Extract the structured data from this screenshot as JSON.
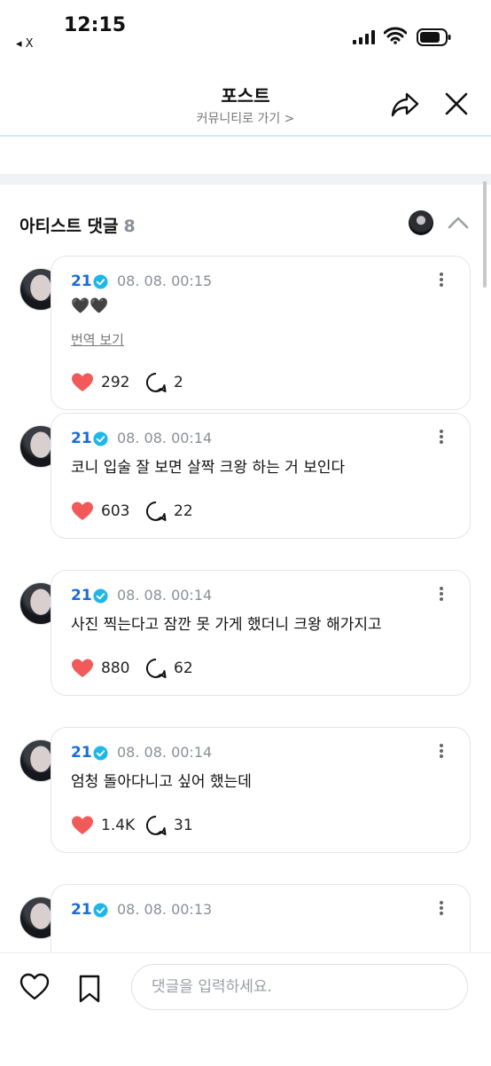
{
  "status_bar": {
    "time": "12:15",
    "back_app": "◂ X"
  },
  "header": {
    "title": "포스트",
    "subtitle": "커뮤니티로 가기 >"
  },
  "section": {
    "title": "아티스트 댓글",
    "count": "8"
  },
  "comments": [
    {
      "author": "21",
      "timestamp": "08. 08. 00:15",
      "text": "🖤🖤",
      "translate": "번역 보기",
      "likes": "292",
      "replies": "2"
    },
    {
      "author": "21",
      "timestamp": "08. 08. 00:14",
      "text": "코니 입술 잘 보면 살짝 크왕 하는 거 보인다",
      "likes": "603",
      "replies": "22"
    },
    {
      "author": "21",
      "timestamp": "08. 08. 00:14",
      "text": "사진 찍는다고 잠깐 못 가게 했더니 크왕 해가지고",
      "likes": "880",
      "replies": "62"
    },
    {
      "author": "21",
      "timestamp": "08. 08. 00:14",
      "text": "엄청 돌아다니고 싶어 했는데",
      "likes": "1.4K",
      "replies": "31"
    },
    {
      "author": "21",
      "timestamp": "08. 08. 00:13"
    }
  ],
  "bottom_bar": {
    "placeholder": "댓글을 입력하세요."
  },
  "colors": {
    "author": "#1c6bd6",
    "verified": "#1fb6e8",
    "like": "#f25a5a",
    "header_rule": "#cfe9f7"
  },
  "icons": [
    "signal-icon",
    "wifi-icon",
    "battery-icon",
    "share-icon",
    "close-icon",
    "chevron-up-icon",
    "verified-icon",
    "more-icon",
    "heart-icon",
    "reply-icon",
    "bookmark-icon"
  ]
}
